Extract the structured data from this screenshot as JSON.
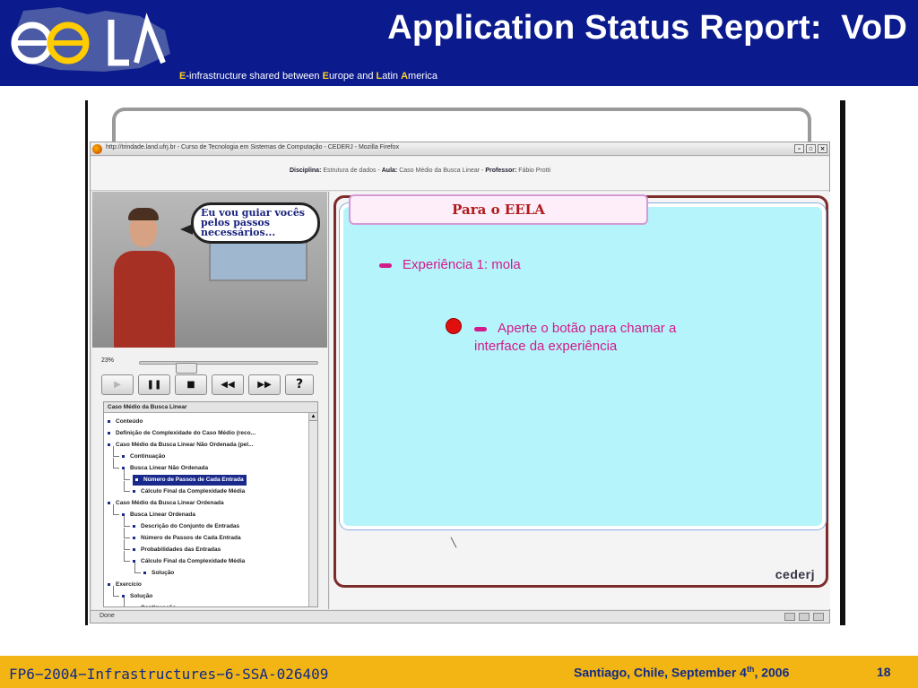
{
  "slide": {
    "title": "Application Status Report:  VoD",
    "tagline_parts": [
      "E",
      "-infrastructure shared between ",
      "E",
      "urope and ",
      "L",
      "atin ",
      "A",
      "merica"
    ],
    "logo_alt": "eeLA"
  },
  "browser": {
    "window_title": "http://trindade.land.ufrj.br - Curso de Tecnologia em Sistemas de Computação - CEDERJ - Mozilla Firefox",
    "window_buttons": [
      "–",
      "▫",
      "×"
    ],
    "discipline_bar": {
      "discipline_label": "Disciplina:",
      "discipline_value": "Estrutura de dados",
      "lesson_label": "Aula:",
      "lesson_value": "Caso Médio da Busca Linear",
      "professor_label": "Professor:",
      "professor_value": "Fábio Protti"
    },
    "status_text": "Done"
  },
  "player": {
    "speech_bubble": "Eu vou guiar vocês pelos passos necessários...",
    "progress_percent": "23%",
    "progress_fraction": 0.23,
    "controls": [
      {
        "name": "play-button",
        "label": "▶",
        "disabled": true
      },
      {
        "name": "pause-button",
        "label": "❚❚",
        "disabled": false
      },
      {
        "name": "stop-button",
        "label": "■",
        "disabled": false
      },
      {
        "name": "rewind-button",
        "label": "◀◀",
        "disabled": false
      },
      {
        "name": "forward-button",
        "label": "▶▶",
        "disabled": false
      },
      {
        "name": "help-button",
        "label": "?",
        "disabled": false
      }
    ]
  },
  "toc": {
    "header": "Caso Médio da Busca Linear",
    "items": [
      {
        "label": "Conteúdo",
        "level": 0
      },
      {
        "label": "Definição de Complexidade do Caso Médio (reco...",
        "level": 0
      },
      {
        "label": "Caso Médio da Busca Linear Não Ordenada (pel...",
        "level": 0
      },
      {
        "label": "Continuação",
        "level": 1
      },
      {
        "label": "Busca Linear Não Ordenada",
        "level": 1
      },
      {
        "label": "Número de Passos de Cada Entrada",
        "level": 2,
        "selected": true
      },
      {
        "label": "Cálculo Final da Complexidade Média",
        "level": 2
      },
      {
        "label": "Caso Médio da Busca Linear Ordenada",
        "level": 0
      },
      {
        "label": "Busca Linear Ordenada",
        "level": 1
      },
      {
        "label": "Descrição do Conjunto de Entradas",
        "level": 2
      },
      {
        "label": "Número de Passos de Cada Entrada",
        "level": 2
      },
      {
        "label": "Probabilidades das Entradas",
        "level": 2
      },
      {
        "label": "Cálculo Final da Complexidade Média",
        "level": 2
      },
      {
        "label": "Solução",
        "level": 3
      },
      {
        "label": "Exercício",
        "level": 0
      },
      {
        "label": "Solução",
        "level": 1
      },
      {
        "label": "Continuação",
        "level": 2
      }
    ]
  },
  "panel": {
    "tab_title": "Para o EELA",
    "experience": "Experiência 1: mola",
    "instruction_line1": "Aperte o botão para chamar a",
    "instruction_line2": "interface da experiência",
    "brand": "cederj"
  },
  "footer": {
    "project_code": "FP6−2004−Infrastructures−6-SSA-026409",
    "location_date_pre": "Santiago, Chile, September 4",
    "location_date_sup": "th",
    "location_date_post": ", 2006",
    "page_number": "18"
  },
  "colors": {
    "header_bg": "#0b1a8c",
    "footer_bg": "#f3b513",
    "accent_yellow": "#ffd21a",
    "panel_bg": "#b6f4fb",
    "panel_text": "#d21a8a"
  }
}
